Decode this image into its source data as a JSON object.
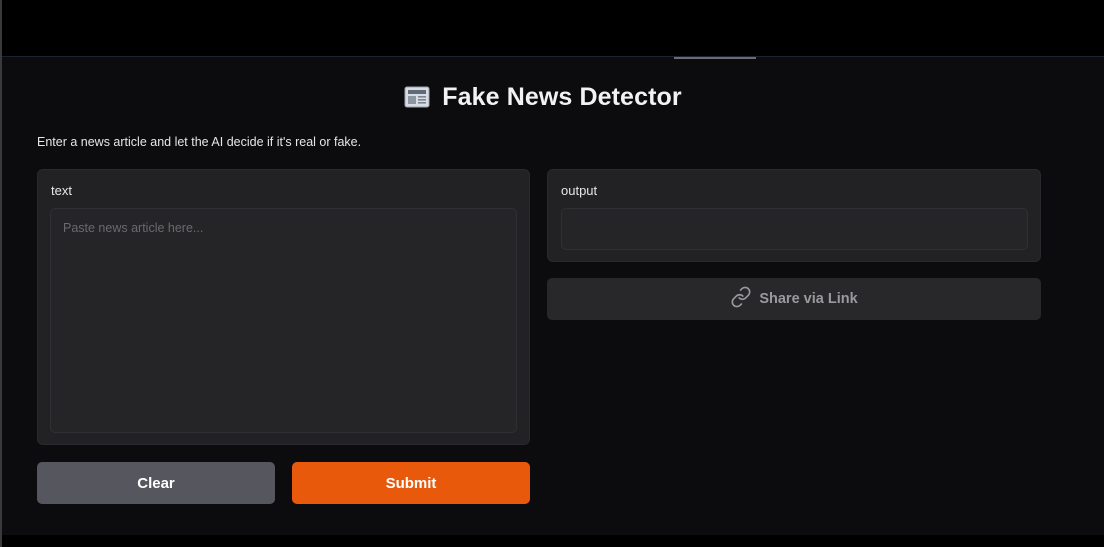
{
  "header": {
    "title": "Fake News Detector",
    "title_icon": "newspaper-icon"
  },
  "description": "Enter a news article and let the AI decide if it's real or fake.",
  "input_panel": {
    "label": "text",
    "value": "",
    "placeholder": "Paste news article here..."
  },
  "output_panel": {
    "label": "output",
    "value": ""
  },
  "share": {
    "label": "Share via Link",
    "icon": "link-icon"
  },
  "actions": {
    "clear_label": "Clear",
    "submit_label": "Submit"
  },
  "colors": {
    "accent": "#e8590c",
    "background": "#0c0c0f",
    "panel": "#222225",
    "secondary_button": "#56565e"
  }
}
